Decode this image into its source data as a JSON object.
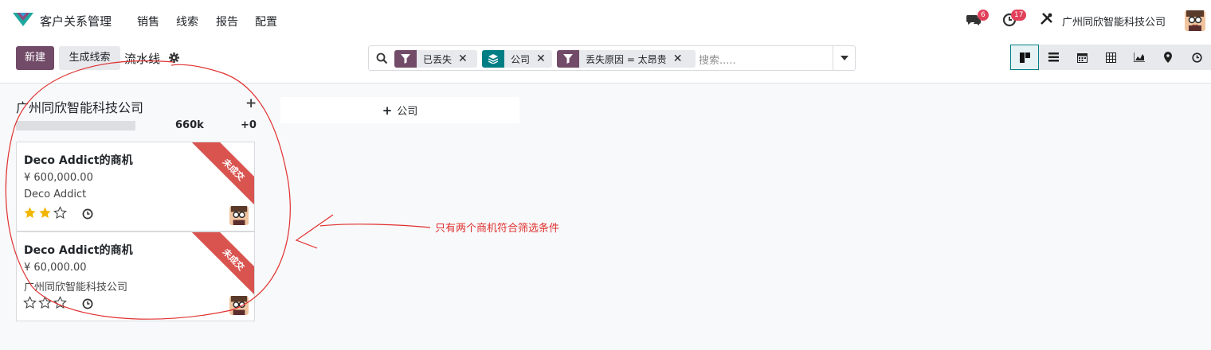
{
  "topnav": {
    "app_title": "客户关系管理",
    "menu": [
      "销售",
      "线索",
      "报告",
      "配置"
    ],
    "chat_badge": "6",
    "activity_badge": "17",
    "company": "广州同欣智能科技公司"
  },
  "control": {
    "new_label": "新建",
    "generate_label": "生成线索",
    "breadcrumb": "流水线",
    "facets": [
      {
        "icon": "filter-icon",
        "label": "已丢失",
        "color": "#714b67"
      },
      {
        "icon": "layers-icon",
        "label": "公司",
        "color": "#017e84"
      },
      {
        "icon": "filter-icon",
        "label": "丢失原因 = 太昂贵",
        "color": "#714b67"
      }
    ],
    "search_placeholder": "搜索.....",
    "views": [
      "kanban-view-icon",
      "list-view-icon",
      "calendar-view-icon",
      "pivot-view-icon",
      "graph-view-icon",
      "map-view-icon",
      "activity-view-icon"
    ],
    "active_view": "kanban-view-icon"
  },
  "kanban": {
    "column_title": "广州同欣智能科技公司",
    "column_sum": "660k",
    "column_diff": "+0",
    "add_column_label": "公司",
    "cards": [
      {
        "title": "Deco Addict的商机",
        "amount": "¥ 600,000.00",
        "customer": "Deco Addict",
        "stars": 2,
        "ribbon": "未成交"
      },
      {
        "title": "Deco Addict的商机",
        "amount": "¥ 60,000.00",
        "customer": "广州同欣智能科技公司",
        "stars": 0,
        "ribbon": "未成交"
      }
    ]
  },
  "annotation": "只有两个商机符合筛选条件",
  "colors": {
    "primary": "#714b67",
    "teal": "#017e84",
    "ribbon": "#d9534f",
    "annotation": "#e0302f",
    "star": "#f3b600"
  }
}
